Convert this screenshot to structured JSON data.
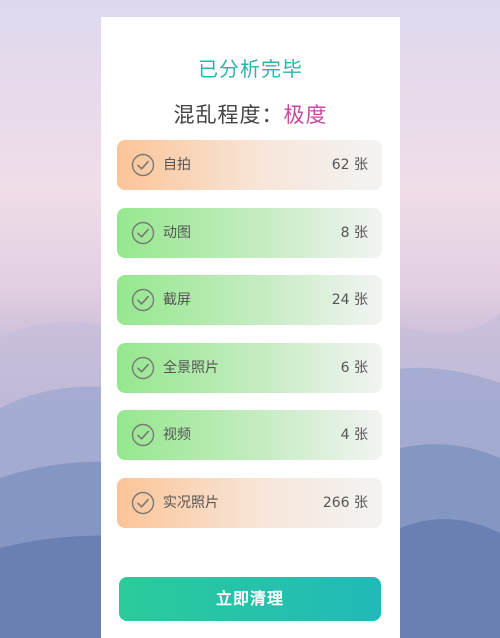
{
  "status_title": "已分析完毕",
  "level": {
    "label": "混乱程度：",
    "value": "极度"
  },
  "categories": [
    {
      "label": "自拍",
      "count": "62 张",
      "color": "orange"
    },
    {
      "label": "动图",
      "count": "8 张",
      "color": "green"
    },
    {
      "label": "截屏",
      "count": "24 张",
      "color": "green"
    },
    {
      "label": "全景照片",
      "count": "6 张",
      "color": "green"
    },
    {
      "label": "视频",
      "count": "4 张",
      "color": "green"
    },
    {
      "label": "实况照片",
      "count": "266 张",
      "color": "orange"
    }
  ],
  "action": {
    "clean_label": "立即清理"
  },
  "colors": {
    "title_teal": "#2fb3a8",
    "level_magenta": "#c84a9c",
    "orange_row": "#fcc497",
    "green_row": "#95e88e",
    "button_start": "#2ccb9a",
    "button_end": "#22b9b9"
  }
}
